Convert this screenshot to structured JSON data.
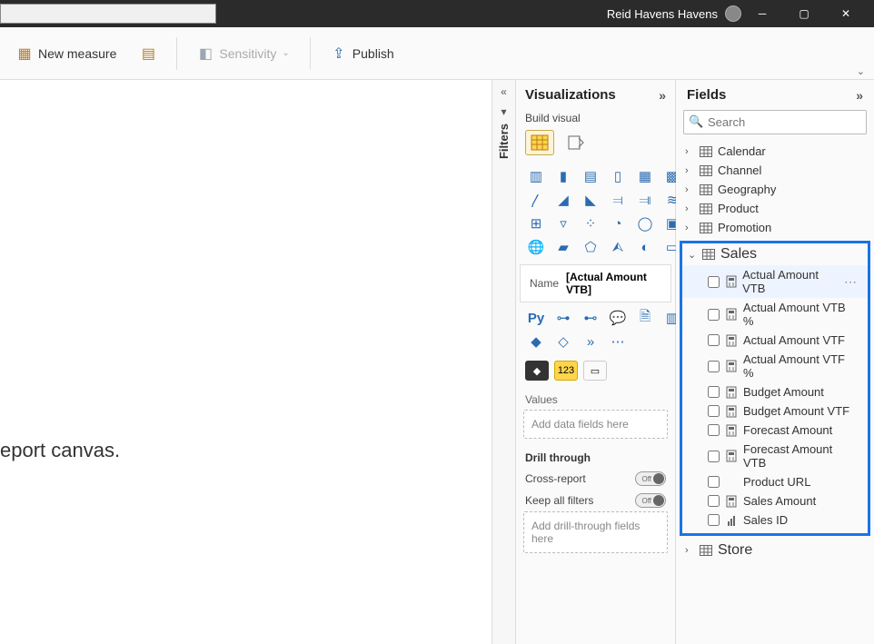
{
  "titlebar": {
    "user": "Reid Havens Havens"
  },
  "ribbon": {
    "new_measure": "New measure",
    "sensitivity": "Sensitivity",
    "publish": "Publish"
  },
  "canvas": {
    "hint": "eport canvas."
  },
  "filters": {
    "label": "Filters"
  },
  "visualizations": {
    "title": "Visualizations",
    "subtitle": "Build visual",
    "tooltip_name_label": "Name",
    "tooltip_value": "[Actual Amount VTB]",
    "py_label": "Py",
    "values_label": "Values",
    "values_placeholder": "Add data fields here",
    "drill_label": "Drill through",
    "cross_report": "Cross-report",
    "keep_filters": "Keep all filters",
    "drill_placeholder": "Add drill-through fields here",
    "toggle_off": "Off",
    "num_chip": "123"
  },
  "fields": {
    "title": "Fields",
    "search_placeholder": "Search",
    "tables": [
      {
        "name": "Calendar",
        "expanded": false
      },
      {
        "name": "Channel",
        "expanded": false
      },
      {
        "name": "Geography",
        "expanded": false
      },
      {
        "name": "Product",
        "expanded": false
      },
      {
        "name": "Promotion",
        "expanded": false
      }
    ],
    "sales_label": "Sales",
    "sales_fields": [
      {
        "label": "Actual Amount VTB",
        "icon": "measure",
        "hovered": true,
        "ellipsis": true
      },
      {
        "label": "Actual Amount VTB %",
        "icon": "measure"
      },
      {
        "label": "Actual Amount VTF",
        "icon": "measure"
      },
      {
        "label": "Actual Amount VTF %",
        "icon": "measure"
      },
      {
        "label": "Budget Amount",
        "icon": "measure"
      },
      {
        "label": "Budget Amount VTF",
        "icon": "measure"
      },
      {
        "label": "Forecast Amount",
        "icon": "measure"
      },
      {
        "label": "Forecast Amount VTB",
        "icon": "measure"
      },
      {
        "label": "Product URL",
        "icon": "none"
      },
      {
        "label": "Sales Amount",
        "icon": "measure"
      },
      {
        "label": "Sales ID",
        "icon": "column"
      }
    ],
    "store_label": "Store"
  }
}
